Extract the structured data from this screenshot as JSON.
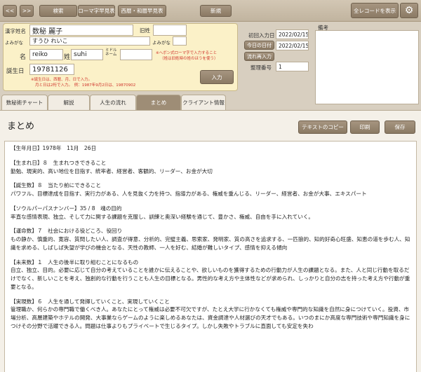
{
  "toolbar": {
    "prev": "<<",
    "next": ">>",
    "search": "検索",
    "romaji_table": "ローマ字早見表",
    "era_table": "西暦・和暦早見表",
    "new": "新規",
    "show_all": "全レコードを表示"
  },
  "form": {
    "kanji_label": "漢字姓名",
    "kanji_value": "数秘 麗子",
    "old_surname_label": "旧姓",
    "old_surname_value": "",
    "yomigana_label": "よみがな",
    "yomigana_value": "すうひ れいこ",
    "yomigana2_label": "よみがな",
    "yomigana2_value": "",
    "first_name_label": "名",
    "first_name_value": "reiko",
    "last_name_label": "姓",
    "last_name_value": "suhi",
    "middle_name_label": "ミドル\nネーム",
    "middle_name_value": "",
    "hepburn_note_1": "※ヘボン式ローマ字で入力すること",
    "hepburn_note_2": "（姓は旧姓時の姓のほうを使う）",
    "birthday_label": "誕生日",
    "birthday_value": "19781126",
    "birthday_note_1": "※誕生日は、西暦、月、日で入力。",
    "birthday_note_2": "月と日は2桁で入力。　例：1987年9月2日は、19870902",
    "submit": "入力"
  },
  "meta": {
    "first_input_label": "初回入力日",
    "first_input_value": "2022/02/15",
    "today_button": "今日の日付",
    "today_value": "2022/02/15",
    "flow_button": "流れ再入力",
    "number_label": "整理番号",
    "number_value": "1",
    "notes_label": "備考",
    "notes_value": ""
  },
  "tabs": [
    "数秘術チャート",
    "解説",
    "人生の流れ",
    "まとめ",
    "クライアント情報"
  ],
  "main": {
    "title": "まとめ",
    "copy_button": "テキストのコピー",
    "print_button": "印刷",
    "save_button": "保存"
  },
  "summary": [
    {
      "head": "【生年月日】1978年　11月　26日",
      "body": ""
    },
    {
      "head": "【生まれ日】８　生まれつきできること",
      "body": "勤勉、現実的、高い地位を目指す、統率者、経営者、客観的、リーダー、お金が大切"
    },
    {
      "head": "【誕生数】８　当たり前にできること",
      "body": "パワフル、目標達成を目指す、実行力がある、人を見抜く力を持つ、指導力がある、権威を重んじる、リーダー、経営者、お金が大事、エキスパート"
    },
    {
      "head": "【ソウルパーパスナンバー】35 / 8　魂の目的",
      "body": "率直な感情表現、独立、そして力に関する課題を克服し、訓練と奥深い経験を通じて、豊かさ、権威、自由を手に入れていく。"
    },
    {
      "head": "【運命数】７　社会における役どころ、役回り",
      "body": "もの静か、慎重的、寛容、質問したい人、調査が得意、分析的、完璧主義、思索家、発明家、質の高さを追求する、一匹狼的、知的好奇心旺盛、知恵の道を歩む人、知識を求める、しばしば失望が学びの機会となる、天性の教師、一人を好む、結婚が難しいタイプ、感情を抑える傾向"
    },
    {
      "head": "【未来数】１　人生の後半に取り組むことになるもの",
      "body": "自立、独立、目的。必要に応じて自分の考えていることを誰かに伝えることや、欲しいものを獲得するための行動力が人生の課題となる。また、人と同じ行動を取るだけでなく、新しいことを考え、独創的な行動を行うことも人生の目標となる。男性的な考え方や主体性などが求められ、しっかりと自分の志を持った考え方や行動が重要となる。"
    },
    {
      "head": "【実現数】６　人生を通して発揮していくこと、実現していくこと",
      "body": "管理職か、何らかの専門職で働くべき人。あなたにとって権威は必要不可欠ですが、たとえ大学に行かなくても権威や専門的な知識を自然に身につけていく。投資、市場分析、高層建築やホテルの開発、大事業ならゲームのように楽しめるあなたは、資金調達や人材選びの天才でもある。いつのまにか高度な専門技術や専門知識を身につけその分野で活躍できる人。問題は仕事よりもプライベートで生じるタイプ。しかし失敗やトラブルに直面しても安定を失わ"
    }
  ]
}
